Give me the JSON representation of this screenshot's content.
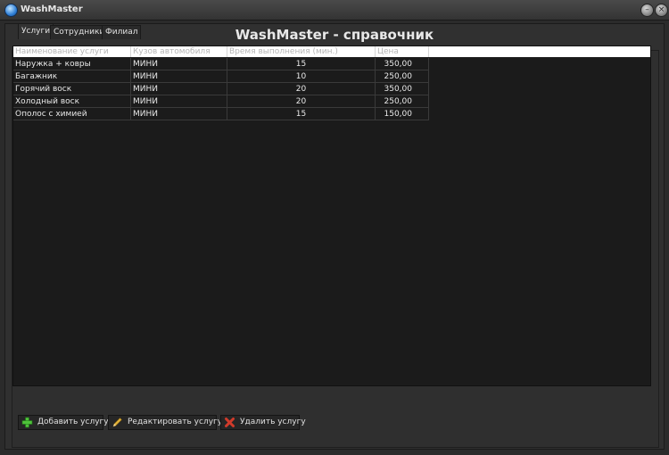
{
  "window": {
    "title": "WashMaster"
  },
  "header": {
    "title": "WashMaster - справочник"
  },
  "tabs": [
    {
      "label": "Услуги",
      "active": true
    },
    {
      "label": "Сотрудники",
      "active": false
    },
    {
      "label": "Филиал",
      "active": false
    }
  ],
  "table": {
    "columns": [
      "Наименование услуги",
      "Кузов автомобиля",
      "Время выполнения (мин.)",
      "Цена"
    ],
    "rows": [
      [
        "Наружка + ковры",
        "МИНИ",
        "15",
        "350,00"
      ],
      [
        "Багажник",
        "МИНИ",
        "10",
        "250,00"
      ],
      [
        "Горячий воск",
        "МИНИ",
        "20",
        "350,00"
      ],
      [
        "Холодный воск",
        "МИНИ",
        "20",
        "250,00"
      ],
      [
        "Ополос с химией",
        "МИНИ",
        "15",
        "150,00"
      ]
    ]
  },
  "buttons": {
    "add": "Добавить услугу",
    "edit": "Редактировать услугу",
    "delete": "Удалить услугу"
  },
  "icons": [
    "app-icon",
    "minimize-icon",
    "close-icon",
    "plus-icon",
    "pencil-icon",
    "delete-x-icon"
  ],
  "colors": {
    "plus": "#4fc33a",
    "pencil": "#e2b33b",
    "delete": "#d13b2b",
    "header_bg": "#ffffff"
  }
}
